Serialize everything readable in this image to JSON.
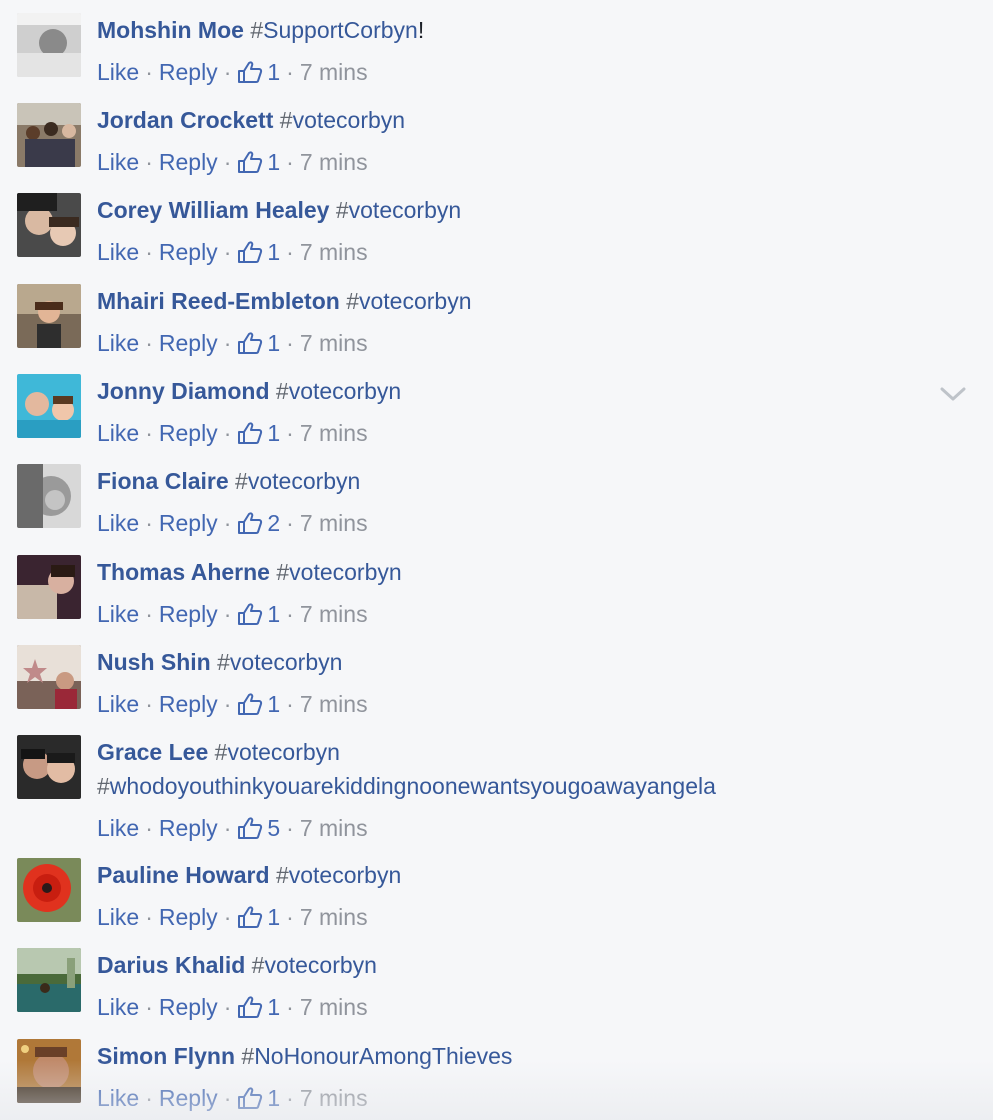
{
  "action_labels": {
    "like": "Like",
    "reply": "Reply",
    "separator": "·"
  },
  "icons": {
    "like_icon": "thumbs-up-icon",
    "menu_icon": "chevron-down-icon"
  },
  "colors": {
    "author": "#365899",
    "link": "#4267b2",
    "meta": "#90949c",
    "background": "#f6f7f9"
  },
  "comments": [
    {
      "author": "Mohshin Moe",
      "hashtag": "SupportCorbyn",
      "suffix": "!",
      "likes": "1",
      "time": "7 mins"
    },
    {
      "author": "Jordan Crockett",
      "hashtag": "votecorbyn",
      "likes": "1",
      "time": "7 mins"
    },
    {
      "author": "Corey William Healey",
      "hashtag": "votecorbyn",
      "likes": "1",
      "time": "7 mins"
    },
    {
      "author": "Mhairi Reed-Embleton",
      "hashtag": "votecorbyn",
      "likes": "1",
      "time": "7 mins"
    },
    {
      "author": "Jonny Diamond",
      "hashtag": "votecorbyn",
      "likes": "1",
      "time": "7 mins"
    },
    {
      "author": "Fiona Claire",
      "hashtag": "votecorbyn",
      "likes": "2",
      "time": "7 mins"
    },
    {
      "author": "Thomas Aherne",
      "hashtag": "votecorbyn",
      "likes": "1",
      "time": "7 mins"
    },
    {
      "author": "Nush Shin",
      "hashtag": "votecorbyn",
      "likes": "1",
      "time": "7 mins"
    },
    {
      "author": "Grace Lee",
      "hashtag": "votecorbyn",
      "hashtag2": "whodoyouthinkyouarekiddingnoonewantsyougoawayangela",
      "likes": "5",
      "time": "7 mins"
    },
    {
      "author": "Pauline Howard",
      "hashtag": "votecorbyn",
      "likes": "1",
      "time": "7 mins"
    },
    {
      "author": "Darius Khalid",
      "hashtag": "votecorbyn",
      "likes": "1",
      "time": "7 mins"
    },
    {
      "author": "Simon Flynn",
      "hashtag": "NoHonourAmongThieves",
      "likes": "1",
      "time": "7 mins"
    }
  ]
}
